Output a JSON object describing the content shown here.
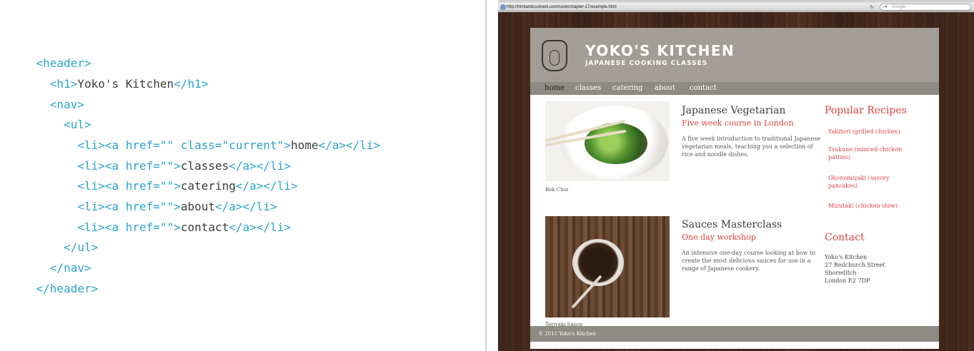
{
  "code_sample": {
    "lines": [
      {
        "indent": "",
        "parts": [
          {
            "t": "tag",
            "v": "<header>"
          }
        ]
      },
      {
        "indent": "  ",
        "parts": [
          {
            "t": "tag",
            "v": "<h1>"
          },
          {
            "t": "txt",
            "v": "Yoko's Kitchen"
          },
          {
            "t": "tag",
            "v": "</h1>"
          }
        ]
      },
      {
        "indent": "  ",
        "parts": [
          {
            "t": "tag",
            "v": "<nav>"
          }
        ]
      },
      {
        "indent": "    ",
        "parts": [
          {
            "t": "tag",
            "v": "<ul>"
          }
        ]
      },
      {
        "indent": "      ",
        "parts": [
          {
            "t": "tag",
            "v": "<li><a href=\"\" class=\"current\">"
          },
          {
            "t": "txt",
            "v": "home"
          },
          {
            "t": "tag",
            "v": "</a></li>"
          }
        ]
      },
      {
        "indent": "      ",
        "parts": [
          {
            "t": "tag",
            "v": "<li><a href=\"\">"
          },
          {
            "t": "txt",
            "v": "classes"
          },
          {
            "t": "tag",
            "v": "</a></li>"
          }
        ]
      },
      {
        "indent": "      ",
        "parts": [
          {
            "t": "tag",
            "v": "<li><a href=\"\">"
          },
          {
            "t": "txt",
            "v": "catering"
          },
          {
            "t": "tag",
            "v": "</a></li>"
          }
        ]
      },
      {
        "indent": "      ",
        "parts": [
          {
            "t": "tag",
            "v": "<li><a href=\"\">"
          },
          {
            "t": "txt",
            "v": "about"
          },
          {
            "t": "tag",
            "v": "</a></li>"
          }
        ]
      },
      {
        "indent": "      ",
        "parts": [
          {
            "t": "tag",
            "v": "<li><a href=\"\">"
          },
          {
            "t": "txt",
            "v": "contact"
          },
          {
            "t": "tag",
            "v": "</a></li>"
          }
        ]
      },
      {
        "indent": "    ",
        "parts": [
          {
            "t": "tag",
            "v": "</ul>"
          }
        ]
      },
      {
        "indent": "  ",
        "parts": [
          {
            "t": "tag",
            "v": "</nav>"
          }
        ]
      },
      {
        "indent": "",
        "parts": [
          {
            "t": "tag",
            "v": "</header>"
          }
        ]
      }
    ]
  },
  "browser": {
    "url": "http://htmlandcssbook.com/code/chapter-17/example.html",
    "reload_icon": "reload-icon",
    "search_placeholder": "Google",
    "search_icon": "search-icon"
  },
  "site": {
    "title": "YOKO'S KITCHEN",
    "tagline": "JAPANESE COOKING CLASSES",
    "logo_icon": "jar-logo-icon",
    "nav": [
      {
        "label": "home",
        "current": true
      },
      {
        "label": "classes",
        "current": false
      },
      {
        "label": "catering",
        "current": false
      },
      {
        "label": "about",
        "current": false
      },
      {
        "label": "contact",
        "current": false
      }
    ],
    "courses": [
      {
        "image_caption": "Bok Choi",
        "title": "Japanese Vegetarian",
        "subtitle": "Five week course in London",
        "description": "A five week introduction to traditional Japanese vegetarian meals, teaching you a selection of rice and noodle dishes."
      },
      {
        "image_caption": "Teriyaki Sauce",
        "title": "Sauces Masterclass",
        "subtitle": "One day workshop",
        "description": "An intensive one-day course looking at how to create the most delicious sauces for use in a range of Japanese cookery."
      }
    ],
    "sidebar": {
      "recipes_heading": "Popular Recipes",
      "recipes": [
        "Yakitori (grilled chicken)",
        "Tsukune (minced chicken patties)",
        "Okonomiyaki (savory pancakes)",
        "Mizutaki (chicken stew)"
      ],
      "contact_heading": "Contact",
      "address": [
        "Yoko's Kitchen",
        "27 Redchurch Street",
        "Shoreditch",
        "London E2 7DP"
      ]
    },
    "footer": "© 2011 Yoko's Kitchen"
  },
  "colors": {
    "code_tag": "#2aa4cf",
    "code_text": "#3c3c3c",
    "accent_red": "#d9443f",
    "header_bg": "#a29d96",
    "nav_bg": "#8e8a84"
  }
}
